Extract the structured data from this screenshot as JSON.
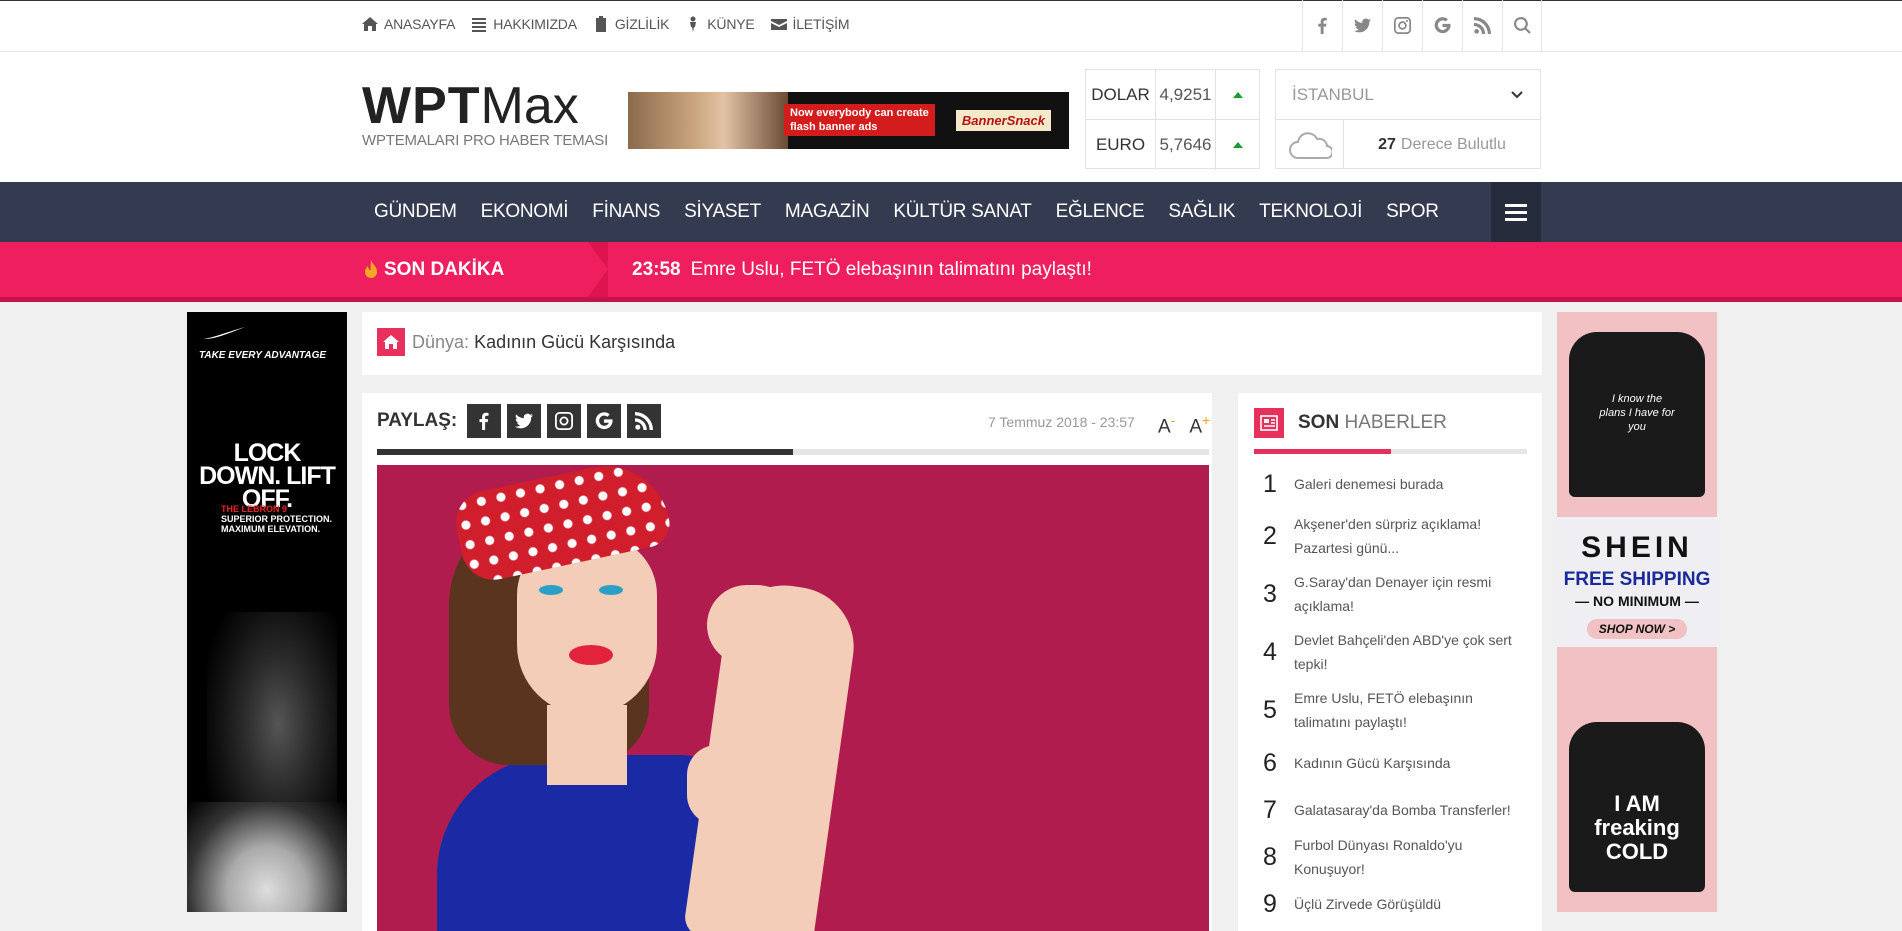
{
  "topnav": [
    {
      "icon": "home-icon",
      "label": "ANASAYFA"
    },
    {
      "icon": "list-icon",
      "label": "HAKKIMIZDA"
    },
    {
      "icon": "clipboard-icon",
      "label": "GİZLİLİK"
    },
    {
      "icon": "user-icon",
      "label": "KÜNYE"
    },
    {
      "icon": "envelope-icon",
      "label": "İLETİŞİM"
    }
  ],
  "social": [
    "facebook-icon",
    "twitter-icon",
    "instagram-icon",
    "google-icon",
    "rss-icon",
    "search-icon"
  ],
  "logo": {
    "bold": "WPT",
    "light": "Max",
    "tagline": "WPTEMALARI PRO HABER TEMASI"
  },
  "banner": {
    "headline_line1": "Now everybody can create",
    "headline_line2": "flash banner ads",
    "brand": "BannerSnack"
  },
  "currency": [
    {
      "name": "DOLAR",
      "value": "4,9251",
      "trend": "up"
    },
    {
      "name": "EURO",
      "value": "5,7646",
      "trend": "up"
    }
  ],
  "weather": {
    "city": "İSTANBUL",
    "temp": "27",
    "unit_text": "Derece Bulutlu"
  },
  "nav": [
    "GÜNDEM",
    "EKONOMİ",
    "FİNANS",
    "SİYASET",
    "MAGAZİN",
    "KÜLTÜR SANAT",
    "EĞLENCE",
    "SAĞLIK",
    "TEKNOLOJİ",
    "SPOR"
  ],
  "breaking": {
    "label": "SON DAKİKA",
    "time": "23:58",
    "headline": "Emre Uslu, FETÖ elebaşının talimatını paylaştı!"
  },
  "ad_left": {
    "brand": "TAKE EVERY ADVANTAGE",
    "headline": "LOCK DOWN. LIFT OFF.",
    "sub1": "THE LEBRON 9",
    "sub2": "SUPERIOR PROTECTION.",
    "sub3": "MAXIMUM ELEVATION."
  },
  "ad_right": {
    "shirt1": "I know the plans I have for you",
    "brand": "SHEIN",
    "offer": "FREE SHIPPING",
    "offer2": "— NO MINIMUM —",
    "cta": "SHOP NOW >",
    "shirt2": "I AM freaking COLD"
  },
  "breadcrumb": {
    "category": "Dünya:",
    "title": "Kadının Gücü Karşısında"
  },
  "article": {
    "share_label": "PAYLAŞ:",
    "share_icons": [
      "facebook-icon",
      "twitter-icon",
      "instagram-icon",
      "google-icon",
      "rss-icon"
    ],
    "date": "7 Temmuz 2018 - 23:57",
    "font_minus": "A",
    "font_plus": "A",
    "minus_sign": "-",
    "plus_sign": "+",
    "read_progress": 0.5
  },
  "sidebar": {
    "title_bold": "SON",
    "title_light": "HABERLER",
    "items": [
      {
        "n": "1",
        "t": "Galeri denemesi burada"
      },
      {
        "n": "2",
        "t": "Akşener'den sürpriz açıklama! Pazartesi günü..."
      },
      {
        "n": "3",
        "t": "G.Saray'dan Denayer için resmi açıklama!"
      },
      {
        "n": "4",
        "t": "Devlet Bahçeli'den ABD'ye çok sert tepki!"
      },
      {
        "n": "5",
        "t": "Emre Uslu, FETÖ elebaşının talimatını paylaştı!"
      },
      {
        "n": "6",
        "t": "Kadının Gücü Karşısında"
      },
      {
        "n": "7",
        "t": "Galatasaray'da Bomba Transferler!"
      },
      {
        "n": "8",
        "t": "Furbol Dünyası Ronaldo'yu Konuşuyor!"
      },
      {
        "n": "9",
        "t": "Üçlü Zirvede Görüşüldü"
      }
    ]
  },
  "colors": {
    "accent": "#ef1f5f",
    "nav_bg": "#343a4f",
    "up": "#1a9c2e"
  }
}
